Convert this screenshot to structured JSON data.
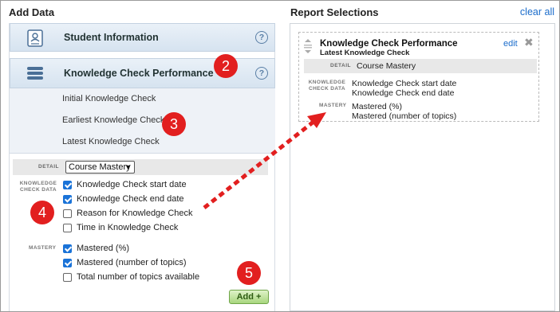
{
  "header": {
    "add_data_title": "Add Data",
    "report_selections_title": "Report Selections",
    "clear_all": "clear all"
  },
  "sections": {
    "student_info": {
      "label": "Student Information",
      "help": "?"
    },
    "knowledge_check": {
      "label": "Knowledge Check Performance",
      "help": "?"
    }
  },
  "sub_items": [
    {
      "label": "Initial Knowledge Check"
    },
    {
      "label": "Earliest Knowledge Check"
    },
    {
      "label": "Latest Knowledge Check"
    }
  ],
  "detail": {
    "label": "DETAIL",
    "selected": "Course Mastery",
    "caret": "▼"
  },
  "knowledge_check_data": {
    "label": "KNOWLEDGE CHECK DATA",
    "options": [
      {
        "label": "Knowledge Check start date",
        "checked": true
      },
      {
        "label": "Knowledge Check end date",
        "checked": true
      },
      {
        "label": "Reason for Knowledge Check",
        "checked": false
      },
      {
        "label": "Time in Knowledge Check",
        "checked": false
      }
    ]
  },
  "mastery": {
    "label": "MASTERY",
    "options": [
      {
        "label": "Mastered (%)",
        "checked": true
      },
      {
        "label": "Mastered (number of topics)",
        "checked": true
      },
      {
        "label": "Total number of topics available",
        "checked": false
      }
    ]
  },
  "add_button": "Add +",
  "card": {
    "title": "Knowledge Check Performance",
    "subtitle": "Latest Knowledge Check",
    "edit": "edit",
    "close": "✖",
    "detail_label": "DETAIL",
    "detail_value": "Course Mastery",
    "kcd_label": "KNOWLEDGE CHECK DATA",
    "kcd_values": [
      "Knowledge Check start date",
      "Knowledge Check end date"
    ],
    "mastery_label": "MASTERY",
    "mastery_values": [
      "Mastered (%)",
      "Mastered (number of topics)"
    ]
  },
  "annotations": [
    "2",
    "3",
    "4",
    "5"
  ],
  "colors": {
    "accent": "#1a73d8",
    "badge": "#e21f1f",
    "link": "#1a6ccb",
    "add_button": "#a8d67e"
  }
}
